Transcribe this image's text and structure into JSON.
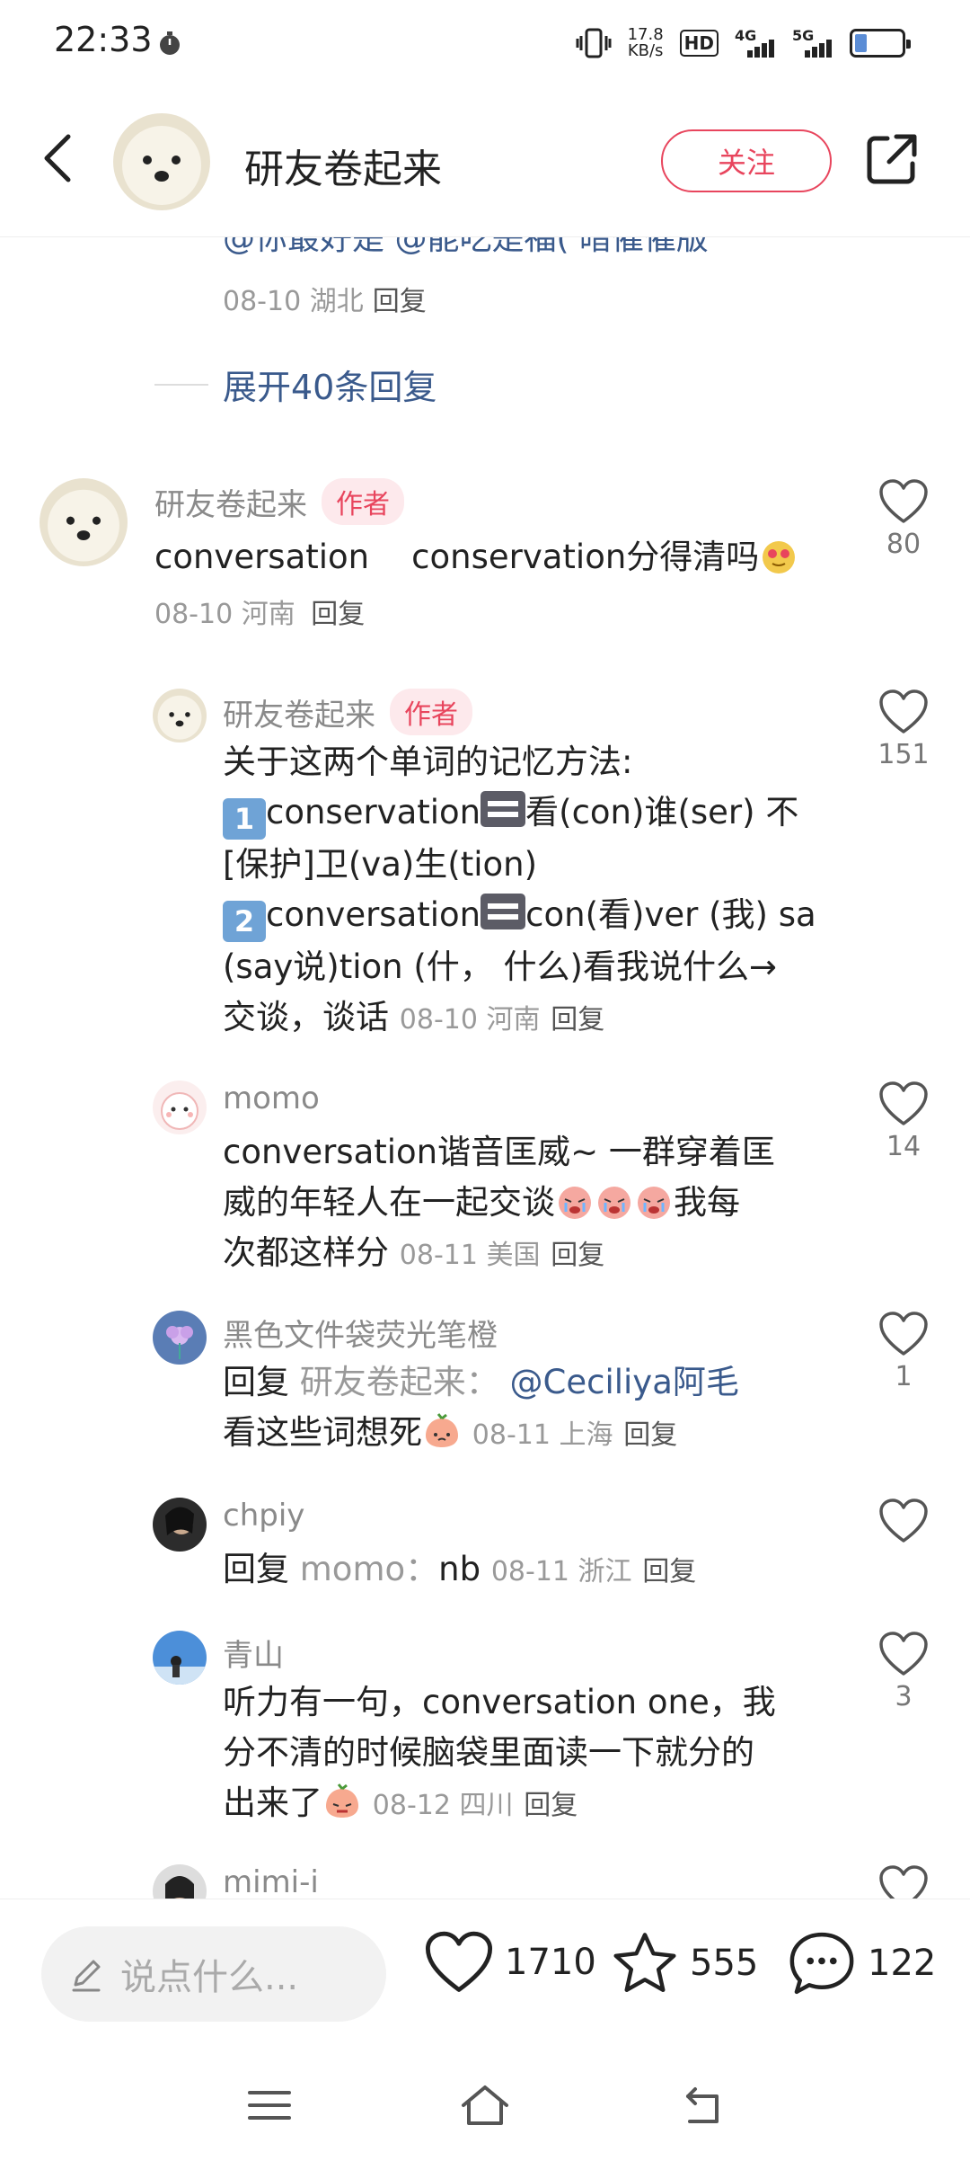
{
  "status": {
    "time": "22:33",
    "speed_top": "17.8",
    "speed_bottom": "KB/s",
    "hd": "HD",
    "sim1": "4G",
    "sim2": "5G"
  },
  "header": {
    "title": "研友卷起来",
    "follow_label": "关注"
  },
  "previous": {
    "cut_text": "@你最好是  @能吃是福( 暗催催版",
    "cut_count": "7",
    "date": "08-10 湖北",
    "reply": "回复",
    "expand_label": "展开40条回复"
  },
  "comments": [
    {
      "name": "研友卷起来",
      "tag": "作者",
      "text": "conversation    conservation分得清吗",
      "date": "08-10 河南",
      "reply": "回复",
      "likes": "80"
    },
    {
      "name": "研友卷起来",
      "tag": "作者",
      "line1": "关于这两个单词的记忆方法:",
      "k1": "1",
      "line2a": "conservation",
      "line2b": "看(con)谁(ser) 不",
      "line3": "[保护]卫(va)生(tion)",
      "k2": "2",
      "line4a": "conversation",
      "line4b": "con(看)ver (我) sa",
      "line5": "(say说)tion (什， 什么)看我说什么→",
      "line6": "交谈，谈话",
      "date": "08-10 河南",
      "reply": "回复",
      "likes": "151"
    },
    {
      "name": "momo",
      "line1": "conversation谐音匡威~ 一群穿着匡",
      "line2a": "威的年轻人在一起交谈",
      "line2b": "我每",
      "line3": "次都这样分",
      "date": "08-11 美国",
      "reply": "回复",
      "likes": "14"
    },
    {
      "name": "黑色文件袋荧光笔橙",
      "prefix": "回复",
      "target": "研友卷起来：",
      "mention": "@Ceciliya阿毛",
      "line2": "看这些词想死",
      "date": "08-11 上海",
      "reply": "回复",
      "likes": "1"
    },
    {
      "name": "chpiy",
      "prefix": "回复",
      "target": "momo：",
      "text": "nb",
      "date": "08-11 浙江",
      "reply": "回复",
      "likes": ""
    },
    {
      "name": "青山",
      "line1": "听力有一句，conversation one，我",
      "line2": "分不清的时候脑袋里面读一下就分的",
      "line3": "出来了",
      "date": "08-12 四川",
      "reply": "回复",
      "likes": "3"
    },
    {
      "name": "mimi-i"
    }
  ],
  "bottom": {
    "placeholder": "说点什么...",
    "likes": "1710",
    "stars": "555",
    "comments": "122"
  },
  "colors": {
    "accent": "#e8455d",
    "link": "#3a5a8c",
    "muted": "#999999"
  }
}
